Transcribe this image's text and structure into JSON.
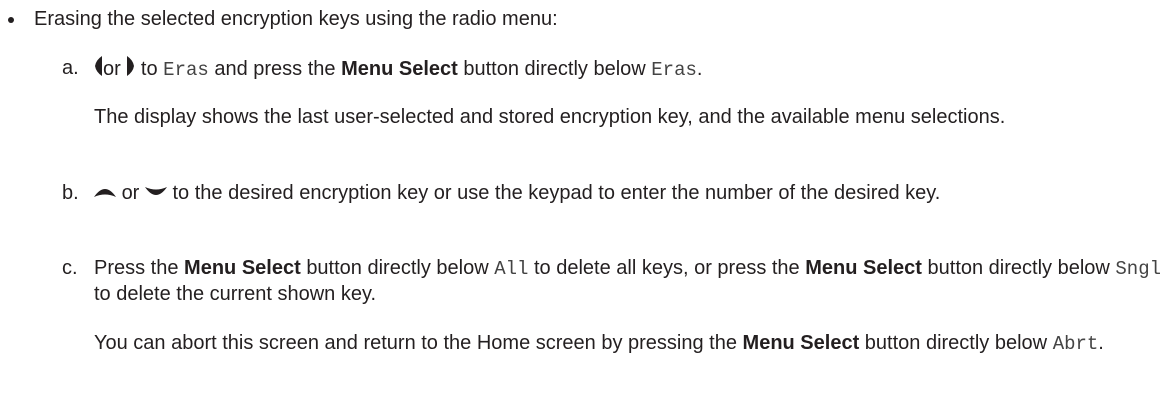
{
  "bullet_item": "Erasing the selected encryption keys using the radio menu:",
  "step_a": {
    "marker": "a.",
    "or": "or",
    "to": "to",
    "menu_code": "Eras",
    "mid": "and press the",
    "button": "Menu Select",
    "after": "button directly below",
    "end": "."
  },
  "step_a_note": "The display shows the last user-selected and stored encryption key, and the available menu selections.",
  "step_b": {
    "marker": "b.",
    "or": "or",
    "text": "to the desired encryption key or use the keypad to enter the number of the desired key."
  },
  "step_c": {
    "marker": "c.",
    "press": "Press the",
    "button": "Menu Select",
    "after1": "button directly below",
    "code1": "All",
    "mid": "to delete all keys, or press the",
    "after2": "button directly below",
    "code2": "Sngl",
    "end": "to delete the current shown key."
  },
  "step_c_note": {
    "text": "You can abort this screen and return to the Home screen by pressing the",
    "button": "Menu Select",
    "after": "button directly below",
    "code": "Abrt",
    "end": "."
  },
  "icons": [
    "left-arrow-icon",
    "right-arrow-icon",
    "up-arrow-icon",
    "down-arrow-icon"
  ]
}
